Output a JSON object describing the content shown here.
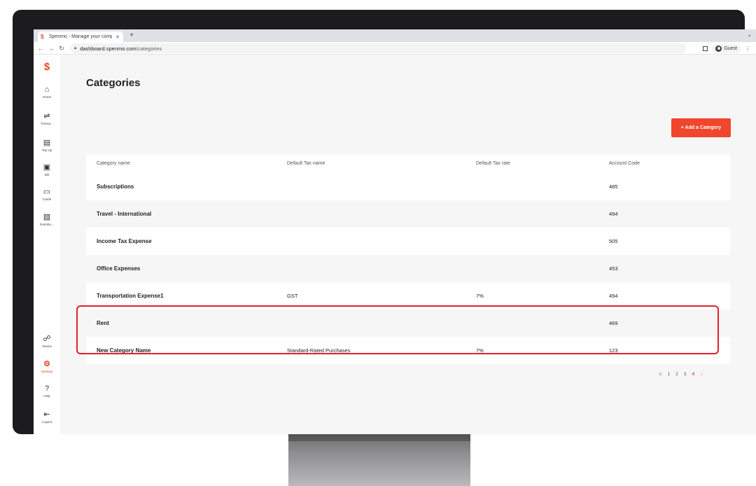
{
  "browser": {
    "tab_title": "Spenmo - Manage your company",
    "new_tab": "+",
    "url_domain": "dashboard.spenmo.com",
    "url_path": "/categories",
    "profile_name": "Guest"
  },
  "sidebar": {
    "items": [
      {
        "label": "Home",
        "icon": "home-icon"
      },
      {
        "label": "Transa...",
        "icon": "transactions-icon"
      },
      {
        "label": "Top Up",
        "icon": "topup-icon"
      },
      {
        "label": "Bill",
        "icon": "bill-icon"
      },
      {
        "label": "Cards",
        "icon": "cards-icon"
      },
      {
        "label": "Reimbu...",
        "icon": "reimbursement-icon"
      },
      {
        "label": "Teams",
        "icon": "teams-icon"
      },
      {
        "label": "Settings",
        "icon": "settings-icon"
      },
      {
        "label": "Help",
        "icon": "help-icon"
      },
      {
        "label": "Logout",
        "icon": "logout-icon"
      }
    ],
    "active": "Settings"
  },
  "page": {
    "title": "Categories",
    "add_button": "+ Add a Category"
  },
  "table": {
    "headers": [
      "Category name",
      "Default Tax name",
      "Default Tax rate",
      "Account Code"
    ],
    "rows": [
      {
        "name": "Subscriptions",
        "tax_name": "",
        "tax_rate": "",
        "code": "485"
      },
      {
        "name": "Travel - International",
        "tax_name": "",
        "tax_rate": "",
        "code": "494"
      },
      {
        "name": "Income Tax Expense",
        "tax_name": "",
        "tax_rate": "",
        "code": "505"
      },
      {
        "name": "Office Expenses",
        "tax_name": "",
        "tax_rate": "",
        "code": "453"
      },
      {
        "name": "Transportation Expense1",
        "tax_name": "GST",
        "tax_rate": "7%",
        "code": "494"
      },
      {
        "name": "Rent",
        "tax_name": "",
        "tax_rate": "",
        "code": "469"
      },
      {
        "name": "New Category Name",
        "tax_name": "Standard-Rated Purchases",
        "tax_rate": "7%",
        "code": "123"
      }
    ]
  },
  "pagination": {
    "prev": "<",
    "pages": [
      "1",
      "2",
      "3",
      "4"
    ],
    "current": "4",
    "next": ">"
  },
  "colors": {
    "accent": "#f0462d",
    "highlight": "#e3202b"
  }
}
